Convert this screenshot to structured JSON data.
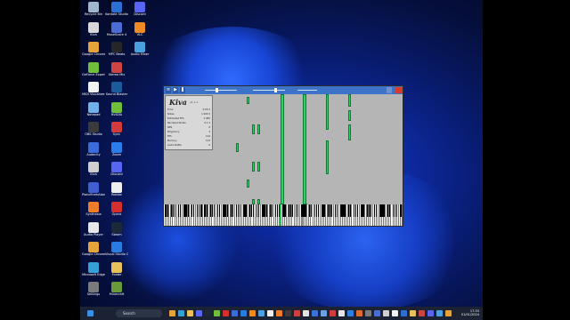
{
  "desktop_icons": [
    {
      "label": "Recycle Bin",
      "color": "#9fb6cc"
    },
    {
      "label": "Kiva",
      "color": "#d8d8d8"
    },
    {
      "label": "Google Chrome",
      "color": "#e5a43a"
    },
    {
      "label": "GeForce Experience",
      "color": "#6fbf3a"
    },
    {
      "label": "MIDI Visualizer",
      "color": "#f2f2f2"
    },
    {
      "label": "Notepad",
      "color": "#6fb1e8"
    },
    {
      "label": "OBS Studio",
      "color": "#3a3a3a"
    },
    {
      "label": "Audacity",
      "color": "#3a6bd8"
    },
    {
      "label": "Kiva",
      "color": "#cfcfcf"
    },
    {
      "label": "PianoFromAbove",
      "color": "#3f5fd2"
    },
    {
      "label": "Synthesia",
      "color": "#ee7d2a"
    },
    {
      "label": "Audio Player",
      "color": "#e6e6e6"
    },
    {
      "label": "Google Chrome",
      "color": "#e5a43a"
    },
    {
      "label": "Microsoft Edge",
      "color": "#35a0d6"
    },
    {
      "label": "Settings",
      "color": "#7a7a7a"
    },
    {
      "label": "Kontakt Studio",
      "color": "#2a6fd1"
    },
    {
      "label": "MuseScore 4",
      "color": "#4a6cd4"
    },
    {
      "label": "MPC Beats",
      "color": "#262626"
    },
    {
      "label": "Stereo Mix",
      "color": "#c44"
    },
    {
      "label": "Sound Blaster",
      "color": "#1c5a9e"
    },
    {
      "label": "NVIDIA",
      "color": "#6fbf3a"
    },
    {
      "label": "Sync",
      "color": "#d23b3b"
    },
    {
      "label": "Zoom",
      "color": "#2b7de9"
    },
    {
      "label": "Discord",
      "color": "#5865f2"
    },
    {
      "label": "Roblox",
      "color": "#efefef"
    },
    {
      "label": "Opera",
      "color": "#d32f2f"
    },
    {
      "label": "Steam",
      "color": "#1b2838"
    },
    {
      "label": "Visual Studio Code",
      "color": "#2a7be0"
    },
    {
      "label": "Folder",
      "color": "#e8c15a"
    },
    {
      "label": "Minecraft",
      "color": "#6a9b3a"
    },
    {
      "label": "Discord",
      "color": "#5865f2"
    },
    {
      "label": "VLC",
      "color": "#f08a24"
    },
    {
      "label": "Audio Mixer",
      "color": "#4aa1e0"
    }
  ],
  "kiva": {
    "logo": "Kiva",
    "version": "v1.1.1",
    "stats": [
      {
        "k": "Time",
        "v": "0:00:1"
      },
      {
        "k": "Notes",
        "v": "1 000 0"
      },
      {
        "k": "Estimated FPS",
        "v": "1 985"
      },
      {
        "k": "Rendered Notes",
        "v": "9 1 2"
      },
      {
        "k": "NPS",
        "v": "0"
      },
      {
        "k": "Polyphony",
        "v": "4"
      },
      {
        "k": "FPS",
        "v": "144"
      },
      {
        "k": "Memory",
        "v": "123"
      },
      {
        "k": "Audio Buffer",
        "v": "0"
      }
    ],
    "colors": {
      "note": "#2cd463",
      "toolbar": "#3c73c9"
    }
  },
  "taskbar": {
    "search_placeholder": "Search",
    "time": "17:33",
    "date": "01/01/2024"
  }
}
